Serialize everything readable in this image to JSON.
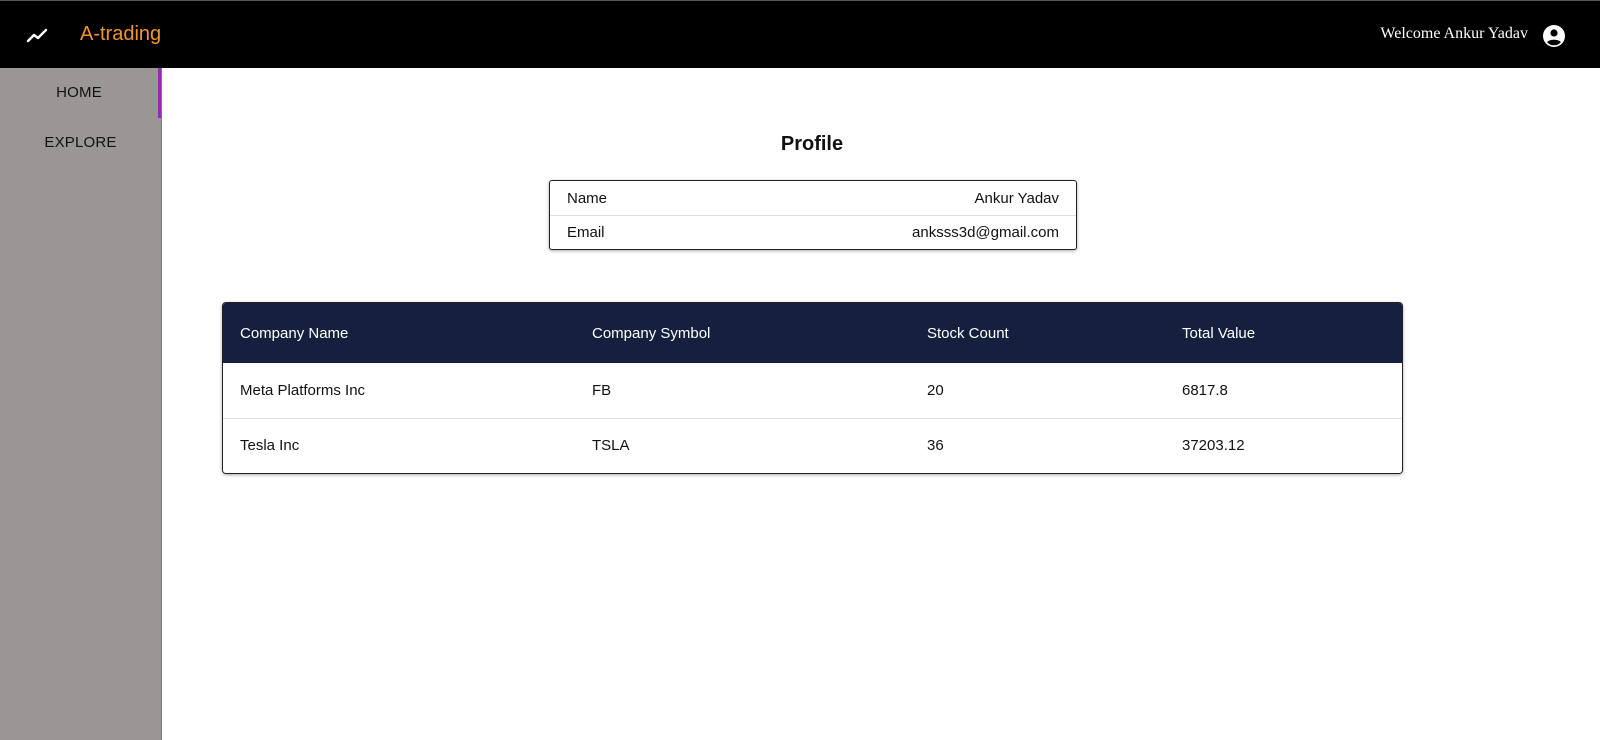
{
  "header": {
    "logo_icon": "trending-up-icon",
    "brand": "A-trading",
    "brand_color": "#f0962e",
    "welcome_text": "Welcome Ankur Yadav",
    "account_icon": "account-circle-icon"
  },
  "sidebar": {
    "items": [
      {
        "label": "HOME",
        "active": true
      },
      {
        "label": "EXPLORE",
        "active": false
      }
    ],
    "active_indicator_color": "#9c27b0"
  },
  "profile": {
    "title": "Profile",
    "rows": [
      {
        "label": "Name",
        "value": "Ankur Yadav"
      },
      {
        "label": "Email",
        "value": "anksss3d@gmail.com"
      }
    ]
  },
  "holdings": {
    "header_color": "#14203d",
    "columns": [
      "Company Name",
      "Company Symbol",
      "Stock Count",
      "Total Value"
    ],
    "rows": [
      [
        "Meta Platforms Inc",
        "FB",
        "20",
        "6817.8"
      ],
      [
        "Tesla Inc",
        "TSLA",
        "36",
        "37203.12"
      ]
    ]
  }
}
